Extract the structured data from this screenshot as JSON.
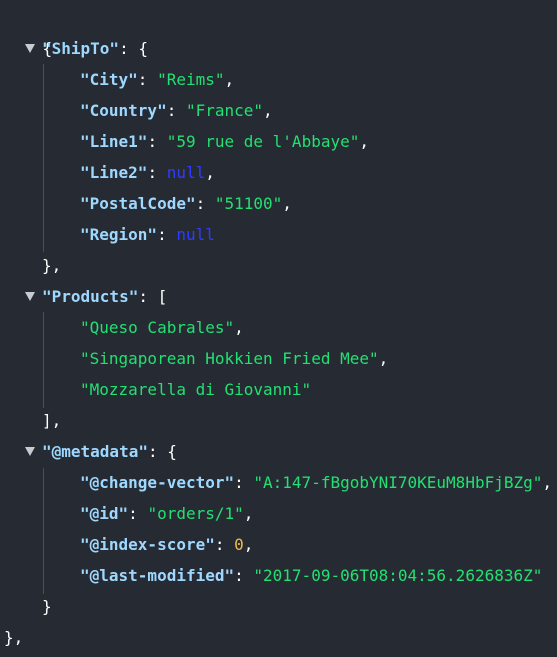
{
  "brackets": {
    "root_open": "{",
    "root_close": "},",
    "obj_open": "{",
    "arr_open": "[",
    "obj_close": "},",
    "arr_close": "],",
    "obj_close_last": "}"
  },
  "punct": {
    "colon": ": ",
    "comma": ","
  },
  "shipto": {
    "key": "\"ShipTo\"",
    "city_key": "\"City\"",
    "city_value": "\"Reims\"",
    "country_key": "\"Country\"",
    "country_value": "\"France\"",
    "line1_key": "\"Line1\"",
    "line1_value": "\"59 rue de l'Abbaye\"",
    "line2_key": "\"Line2\"",
    "line2_value": "null",
    "postal_key": "\"PostalCode\"",
    "postal_value": "\"51100\"",
    "region_key": "\"Region\"",
    "region_value": "null"
  },
  "products": {
    "key": "\"Products\"",
    "items": [
      "\"Queso Cabrales\"",
      "\"Singaporean Hokkien Fried Mee\"",
      "\"Mozzarella di Giovanni\""
    ]
  },
  "metadata": {
    "key": "\"@metadata\"",
    "change_vector_key": "\"@change-vector\"",
    "change_vector_value": "\"A:147-fBgobYNI70KEuM8HbFjBZg\"",
    "id_key": "\"@id\"",
    "id_value": "\"orders/1\"",
    "index_score_key": "\"@index-score\"",
    "index_score_value": "0",
    "last_modified_key": "\"@last-modified\"",
    "last_modified_value": "\"2017-09-06T08:04:56.2626836Z\""
  },
  "colors": {
    "background": "#262b33",
    "key": "#9fd8ff",
    "string": "#22e071",
    "null": "#2f3cff",
    "number": "#f2b94b"
  }
}
